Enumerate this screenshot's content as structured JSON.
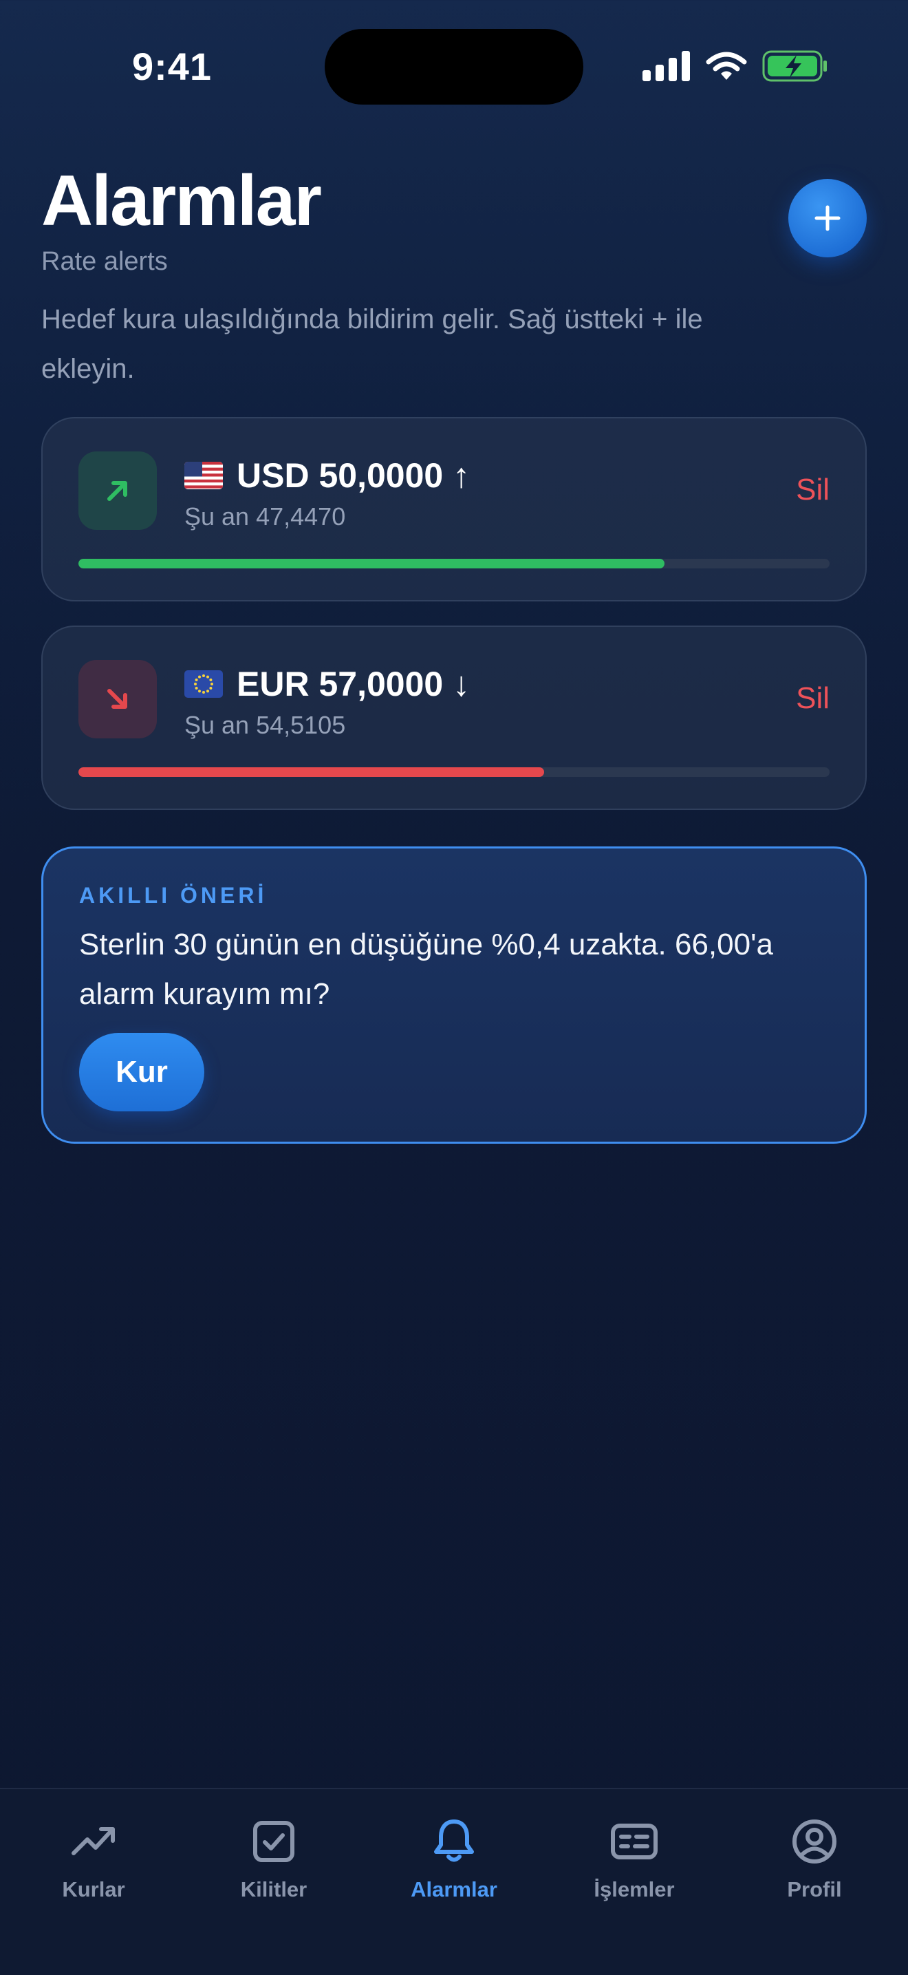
{
  "status_bar": {
    "time": "9:41"
  },
  "header": {
    "title": "Alarmlar",
    "subtitle": "Rate alerts",
    "description": "Hedef kura ulaşıldığında bildirim gelir. Sağ üstteki + ile ekleyin."
  },
  "alerts": [
    {
      "currency": "USD",
      "flag": "us-flag-icon",
      "target_text": "USD 50,0000 ↑",
      "current_text": "Şu an 47,4470",
      "direction": "up",
      "delete_label": "Sil",
      "progress": 0.78,
      "color": "#2fbd62"
    },
    {
      "currency": "EUR",
      "flag": "eu-flag-icon",
      "target_text": "EUR 57,0000 ↓",
      "current_text": "Şu an 54,5105",
      "direction": "down",
      "delete_label": "Sil",
      "progress": 0.62,
      "color": "#e5484d"
    }
  ],
  "suggestion": {
    "label": "AKILLI ÖNERİ",
    "text": "Sterlin 30 günün en düşüğüne %0,4 uzakta. 66,00'a alarm kurayım mı?",
    "button_label": "Kur"
  },
  "tab_bar": {
    "active": "Alarmlar",
    "items": [
      {
        "label": "Kurlar",
        "icon": "trending-up-icon"
      },
      {
        "label": "Kilitler",
        "icon": "checkbox-icon"
      },
      {
        "label": "Alarmlar",
        "icon": "bell-icon"
      },
      {
        "label": "İşlemler",
        "icon": "list-card-icon"
      },
      {
        "label": "Profil",
        "icon": "user-circle-icon"
      }
    ]
  },
  "colors": {
    "accent": "#4d9af5",
    "positive": "#2fbd62",
    "negative": "#e5484d",
    "background": "#0e1a35"
  }
}
